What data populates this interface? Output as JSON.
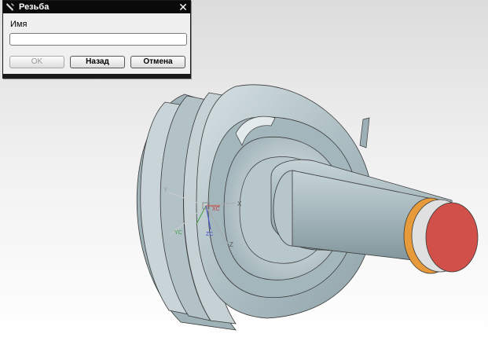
{
  "dialog": {
    "title": "Резьба",
    "field_label": "Имя",
    "name_value": "",
    "ok_label": "OK",
    "back_label": "Назад",
    "cancel_label": "Отмена",
    "close_glyph": "✕"
  },
  "viewport": {
    "axis_labels": {
      "x": "X",
      "y": "Y",
      "z": "Z",
      "xc": "XC",
      "yc": "YC",
      "zc": "ZC"
    }
  },
  "colors": {
    "part_gray": "#b9c8cc",
    "shaft_end_face": "#d2504a",
    "thread_ring": "#e69a3a",
    "dialog_title_bg": "#0a0a0a"
  },
  "icons": [
    "app-icon",
    "close-icon"
  ]
}
